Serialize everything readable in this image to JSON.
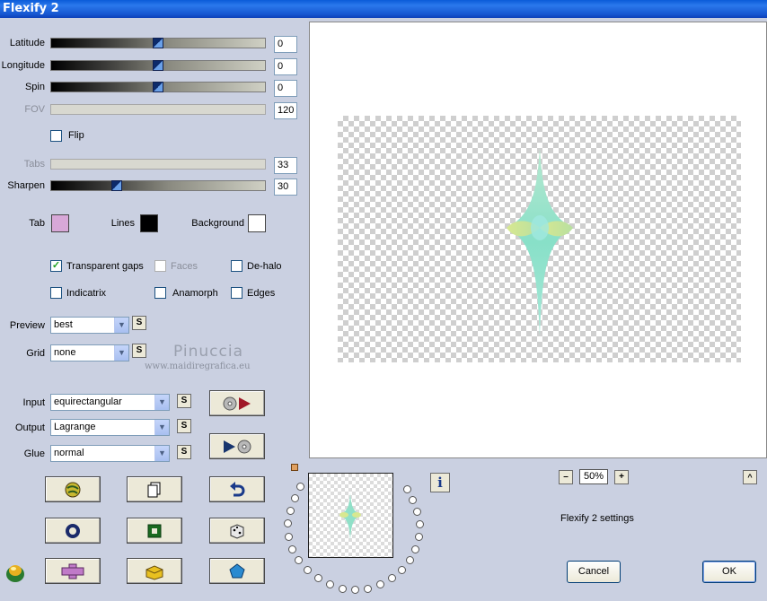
{
  "window": {
    "title": "Flexify 2"
  },
  "sliders": [
    {
      "label": "Latitude",
      "value": "0",
      "enabled": true,
      "level": 0.5
    },
    {
      "label": "Longitude",
      "value": "0",
      "enabled": true,
      "level": 0.5
    },
    {
      "label": "Spin",
      "value": "0",
      "enabled": true,
      "level": 0.5
    },
    {
      "label": "FOV",
      "value": "120",
      "enabled": false
    },
    {
      "label": "Tabs",
      "value": "33",
      "enabled": false
    },
    {
      "label": "Sharpen",
      "value": "30",
      "enabled": true,
      "level": 0.3
    }
  ],
  "flip": {
    "label": "Flip",
    "checked": false
  },
  "colors": {
    "tab": {
      "label": "Tab",
      "color": "#d8a8d8"
    },
    "lines": {
      "label": "Lines",
      "color": "#000000"
    },
    "background": {
      "label": "Background",
      "color": "#ffffff"
    }
  },
  "options": [
    {
      "label": "Transparent gaps",
      "checked": true,
      "enabled": true
    },
    {
      "label": "Faces",
      "checked": false,
      "enabled": false
    },
    {
      "label": "De-halo",
      "checked": false,
      "enabled": true
    },
    {
      "label": "Indicatrix",
      "checked": false,
      "enabled": true
    },
    {
      "label": "Anamorph",
      "checked": false,
      "enabled": true
    },
    {
      "label": "Edges",
      "checked": false,
      "enabled": true
    }
  ],
  "preview_select": {
    "label": "Preview",
    "value": "best",
    "s_label": "S"
  },
  "grid_select": {
    "label": "Grid",
    "value": "none",
    "s_label": "S"
  },
  "watermark": {
    "line1": "Pinuccia",
    "line2": "www.maidiregrafica.eu"
  },
  "input_select": {
    "label": "Input",
    "value": "equirectangular",
    "s_label": "S"
  },
  "output_select": {
    "label": "Output",
    "value": "Lagrange",
    "s_label": "S"
  },
  "glue_select": {
    "label": "Glue",
    "value": "normal",
    "s_label": "S"
  },
  "zoom": {
    "minus": "–",
    "value": "50%",
    "plus": "+"
  },
  "info_label": "i",
  "expand_label": "^",
  "settings_label": "Flexify 2 settings",
  "buttons": {
    "cancel": "Cancel",
    "ok": "OK"
  }
}
